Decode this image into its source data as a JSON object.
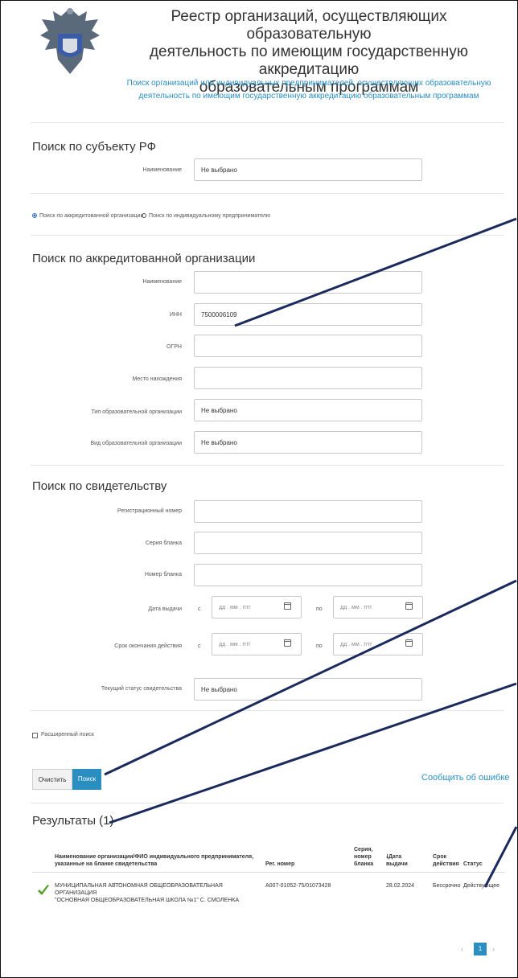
{
  "header": {
    "title_line1": "Реестр организаций, осуществляющих образовательную",
    "title_line2": "деятельность по имеющим государственную аккредитацию",
    "title_line3": "образовательным программам",
    "subtitle_line1": "Поиск организаций или индивидуальных предпринимателей, осуществляющих образовательную",
    "subtitle_line2": "деятельность по имеющим государственную аккредитацию образовательным программам"
  },
  "region": {
    "heading": "Поиск по субъекту РФ",
    "name_label": "Наименование",
    "name_value": "Не выбрано"
  },
  "search_mode": {
    "option_org": "Поиск по аккредитованной организации",
    "option_ip": "Поиск по индивидуальному предпринимателю"
  },
  "org": {
    "heading": "Поиск по аккредитованной организации",
    "name_label": "Наименование",
    "name_value": "",
    "inn_label": "ИНН",
    "inn_value": "7500006109",
    "ogrn_label": "ОГРН",
    "ogrn_value": "",
    "location_label": "Место нахождения",
    "location_value": "",
    "type_label": "Тип образовательной организации",
    "type_value": "Не выбрано",
    "kind_label": "Вид образовательной организации",
    "kind_value": "Не выбрано"
  },
  "cert": {
    "heading": "Поиск по свидетельству",
    "reg_label": "Регистрационный номер",
    "series_label": "Серия бланка",
    "number_label": "Номер бланка",
    "issue_label": "Дата выдачи",
    "expiry_label": "Срок окончания действия",
    "from": "с",
    "to": "по",
    "date_placeholder": "дд . мм . гггг",
    "status_label": "Текущий статус свидетельства",
    "status_value": "Не выбрано"
  },
  "advanced_label": "Расширенный поиск",
  "buttons": {
    "clear": "Очистить",
    "search": "Поиск",
    "report": "Сообщить об ошибке"
  },
  "results": {
    "heading": "Результаты (1)",
    "col_name_1": "Наименование организации/ФИО индивидуального предпринимателя,",
    "col_name_2": "указанные на бланке свидетельства",
    "col_reg": "Рег. номер",
    "col_series_1": "Серия,",
    "col_series_2": "номер",
    "col_series_3": "бланка",
    "col_date_1": "🠗Дата",
    "col_date_2": "выдачи",
    "col_term_1": "Срок",
    "col_term_2": "действия",
    "col_status": "Статус",
    "row_name_1": "МУНИЦИПАЛЬНАЯ АВТОНОМНАЯ ОБЩЕОБРАЗОВАТЕЛЬНАЯ ОРГАНИЗАЦИЯ",
    "row_name_2": "\"ОСНОВНАЯ ОБЩЕОБРАЗОВАТЕЛЬНАЯ ШКОЛА №1\" С. СМОЛЕНКА",
    "row_reg": "А007-01052-75/01073428",
    "row_series": "",
    "row_date": "28.02.2024",
    "row_term": "Бессрочно",
    "row_status": "Действующее"
  },
  "pagination": {
    "prev": "‹",
    "page": "1",
    "next": "›"
  },
  "colors": {
    "accent": "#2a8ec1",
    "check": "#5aa02c",
    "annotation": "#1b2a5c"
  },
  "icons": [
    "emblem-icon",
    "calendar-icon",
    "checkmark-icon"
  ]
}
